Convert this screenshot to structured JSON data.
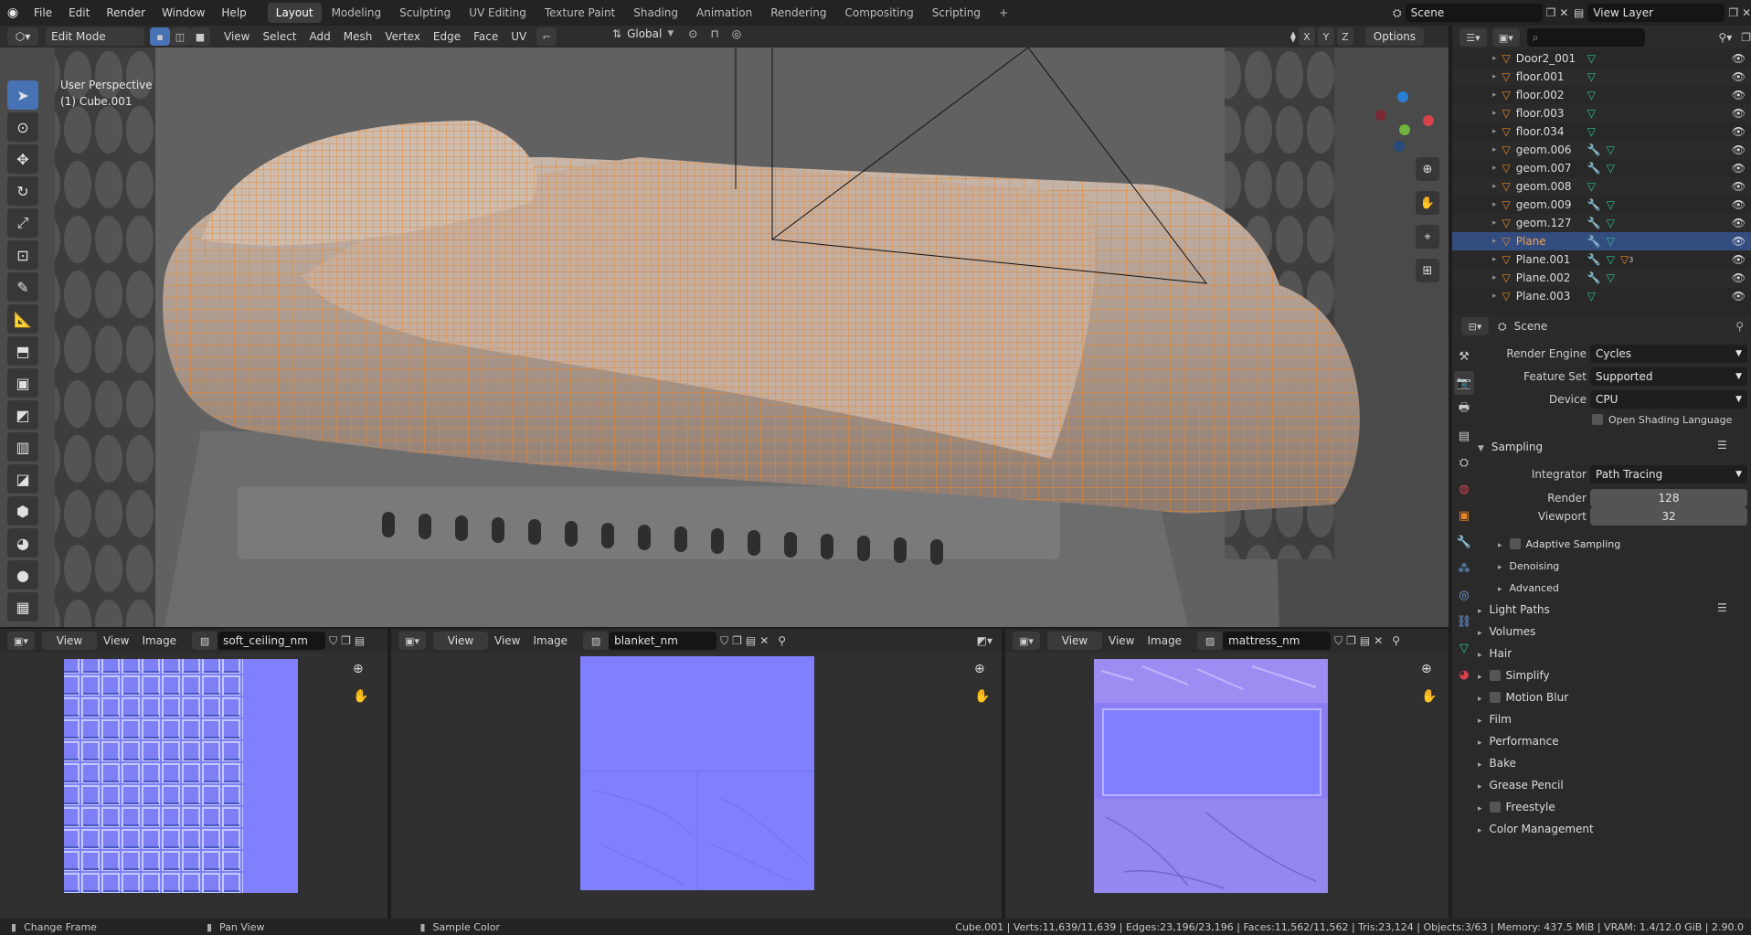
{
  "topbar": {
    "menus": [
      "File",
      "Edit",
      "Render",
      "Window",
      "Help"
    ],
    "workspaces": [
      "Layout",
      "Modeling",
      "Sculpting",
      "UV Editing",
      "Texture Paint",
      "Shading",
      "Animation",
      "Rendering",
      "Compositing",
      "Scripting"
    ],
    "active_workspace": "Layout",
    "add_tab": "+",
    "scene": "Scene",
    "view_layer": "View Layer"
  },
  "viewport_header": {
    "mode": "Edit Mode",
    "menus": [
      "View",
      "Select",
      "Add",
      "Mesh",
      "Vertex",
      "Edge",
      "Face",
      "UV"
    ],
    "orientation": "Global",
    "axes": [
      "X",
      "Y",
      "Z"
    ],
    "options": "Options"
  },
  "viewport": {
    "perspective": "User Perspective",
    "object": "(1) Cube.001",
    "gizmo_axes": [
      "Z",
      "X",
      "Y"
    ]
  },
  "image_editors": [
    {
      "view_menu": "View",
      "menus": [
        "View",
        "Image"
      ],
      "image_name": "soft_ceiling_nm"
    },
    {
      "view_menu": "View",
      "menus": [
        "View",
        "Image"
      ],
      "image_name": "blanket_nm"
    },
    {
      "view_menu": "View",
      "menus": [
        "View",
        "Image"
      ],
      "image_name": "mattress_nm"
    }
  ],
  "outliner": {
    "items": [
      {
        "name": "Door2_001",
        "modifier": false,
        "selected": false
      },
      {
        "name": "floor.001",
        "modifier": false,
        "selected": false
      },
      {
        "name": "floor.002",
        "modifier": false,
        "selected": false
      },
      {
        "name": "floor.003",
        "modifier": false,
        "selected": false
      },
      {
        "name": "floor.034",
        "modifier": false,
        "selected": false
      },
      {
        "name": "geom.006",
        "modifier": true,
        "selected": false
      },
      {
        "name": "geom.007",
        "modifier": true,
        "selected": false
      },
      {
        "name": "geom.008",
        "modifier": false,
        "selected": false
      },
      {
        "name": "geom.009",
        "modifier": true,
        "selected": false
      },
      {
        "name": "geom.127",
        "modifier": true,
        "selected": false
      },
      {
        "name": "Plane",
        "modifier": true,
        "selected": true
      },
      {
        "name": "Plane.001",
        "modifier": true,
        "selected": false,
        "badge": "3"
      },
      {
        "name": "Plane.002",
        "modifier": true,
        "selected": false
      },
      {
        "name": "Plane.003",
        "modifier": false,
        "selected": false
      }
    ]
  },
  "properties": {
    "context": "Scene",
    "render_engine_label": "Render Engine",
    "render_engine": "Cycles",
    "feature_set_label": "Feature Set",
    "feature_set": "Supported",
    "device_label": "Device",
    "device": "CPU",
    "osl_label": "Open Shading Language",
    "sampling": "Sampling",
    "integrator_label": "Integrator",
    "integrator": "Path Tracing",
    "render_label": "Render",
    "render_samples": "128",
    "viewport_label": "Viewport",
    "viewport_samples": "32",
    "subpanels": [
      "Adaptive Sampling",
      "Denoising",
      "Advanced"
    ],
    "panels": [
      "Light Paths",
      "Volumes",
      "Hair",
      "Simplify",
      "Motion Blur",
      "Film",
      "Performance",
      "Bake",
      "Grease Pencil",
      "Freestyle",
      "Color Management"
    ]
  },
  "statusbar": {
    "hint1": "Change Frame",
    "hint2": "Pan View",
    "hint3": "Sample Color",
    "stats": "Cube.001 | Verts:11,639/11,639 | Edges:23,196/23,196 | Faces:11,562/11,562 | Tris:23,124 | Objects:3/63 | Memory: 437.5 MiB | VRAM: 1.4/12.0 GiB | 2.90.0"
  },
  "colors": {
    "accent": "#4772b3",
    "mesh_wire": "#e8862a",
    "normal_map": "#8080ff"
  }
}
